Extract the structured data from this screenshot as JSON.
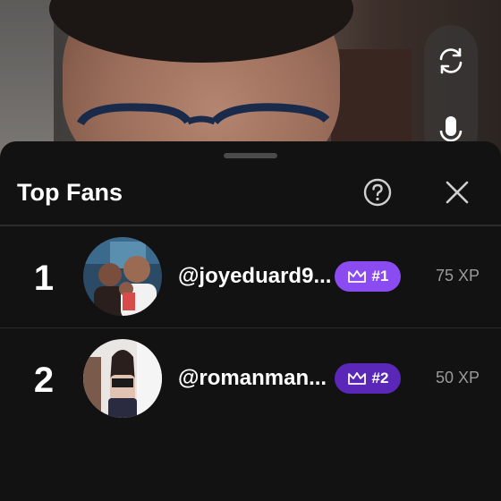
{
  "camera": {
    "flip_icon": "camera-flip-icon",
    "mic_icon": "microphone-icon"
  },
  "sheet": {
    "title": "Top Fans",
    "help_icon": "question-circle-icon",
    "close_icon": "close-icon"
  },
  "fans": [
    {
      "rank": "1",
      "username": "@joyeduard9...",
      "badge": "#1",
      "badge_color": "#8a4cf0",
      "xp": "75 XP"
    },
    {
      "rank": "2",
      "username": "@romanman...",
      "badge": "#2",
      "badge_color": "#5a27b8",
      "xp": "50 XP"
    }
  ],
  "colors": {
    "sheet_bg": "#121212",
    "badge_primary": "#8a4cf0",
    "badge_secondary": "#5a27b8"
  }
}
